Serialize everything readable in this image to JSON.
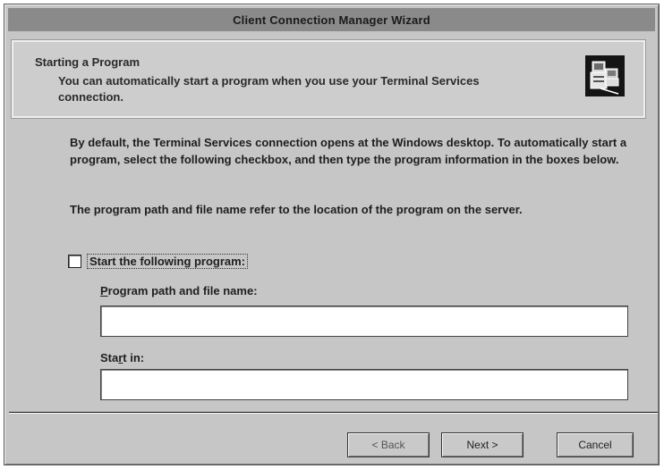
{
  "window": {
    "title": "Client Connection Manager Wizard"
  },
  "header": {
    "title": "Starting a Program",
    "subtitle": "You can automatically start a program when you use your Terminal Services connection.",
    "icon": "computer-program-icon"
  },
  "body": {
    "paragraph1": "By default, the Terminal Services connection opens at the Windows desktop. To automatically start a program, select the following checkbox, and then type the program information in the boxes below.",
    "paragraph2": "The program path and file name refer to the location of the program on the server."
  },
  "checkbox": {
    "label": "Start the following program:",
    "checked": false
  },
  "fields": {
    "path_label_mnemonic": "P",
    "path_label_rest": "rogram path and file name:",
    "path_value": "",
    "startin_label_pre": "Sta",
    "startin_label_mnemonic": "r",
    "startin_label_rest": "t in:",
    "startin_value": ""
  },
  "buttons": {
    "back": "< Back",
    "next": "Next >",
    "cancel": "Cancel"
  }
}
